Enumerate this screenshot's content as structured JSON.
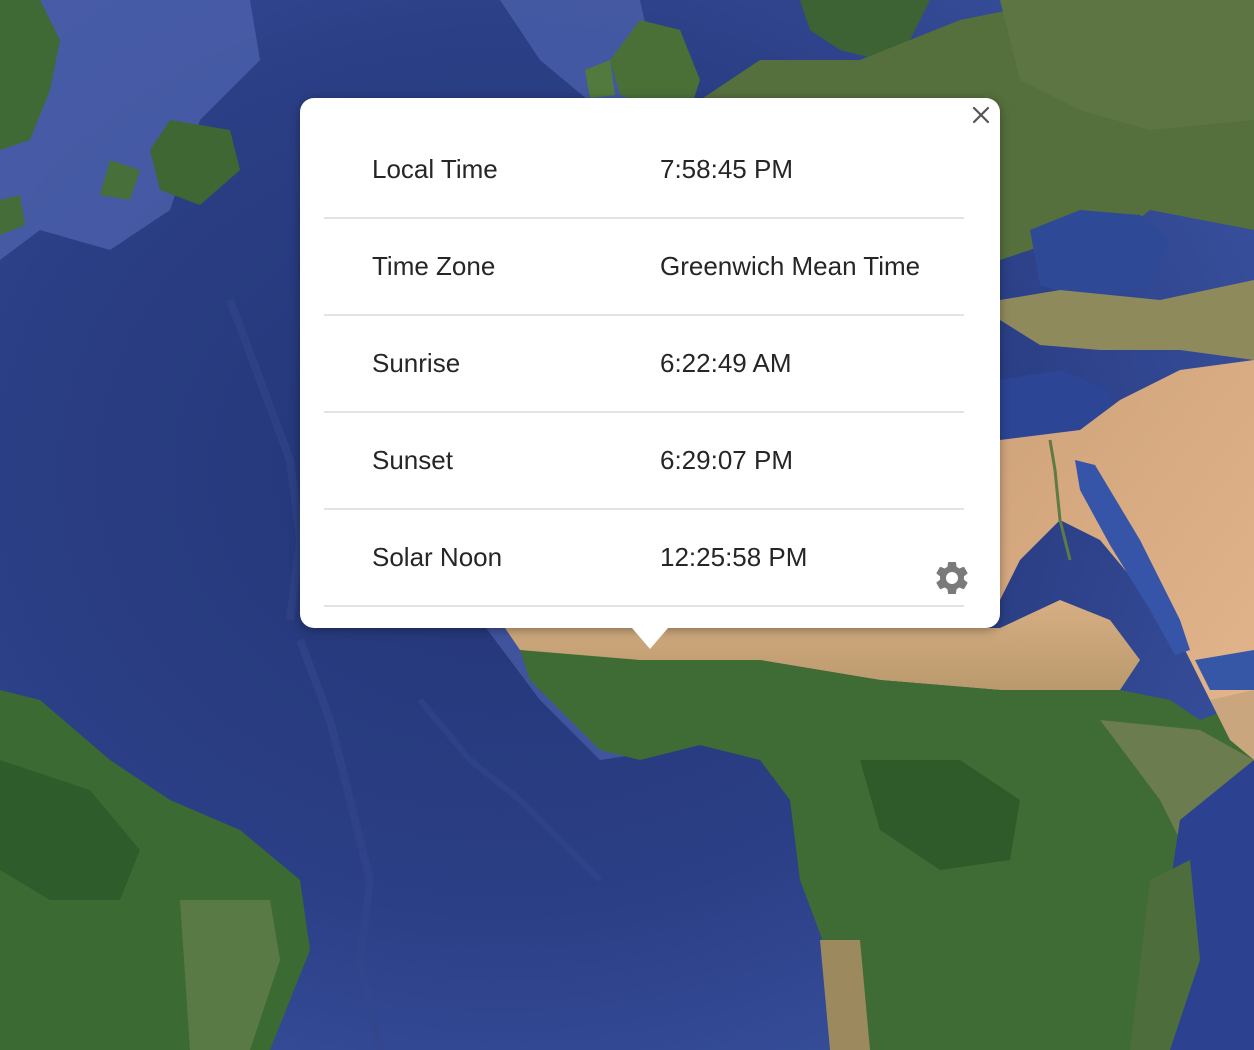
{
  "popup": {
    "rows": [
      {
        "label": "Local Time",
        "value": "7:58:45 PM"
      },
      {
        "label": "Time Zone",
        "value": "Greenwich Mean Time"
      },
      {
        "label": "Sunrise",
        "value": "6:22:49 AM"
      },
      {
        "label": "Sunset",
        "value": "6:29:07 PM"
      },
      {
        "label": "Solar Noon",
        "value": "12:25:58 PM"
      }
    ],
    "close_icon": "close-icon",
    "settings_icon": "gear-icon"
  },
  "colors": {
    "ocean_deep": "#27387a",
    "ocean_shallow": "#4d63b0",
    "land_green": "#3f6b35",
    "land_desert": "#d6a678",
    "icon_gray": "#7a7a7a"
  }
}
